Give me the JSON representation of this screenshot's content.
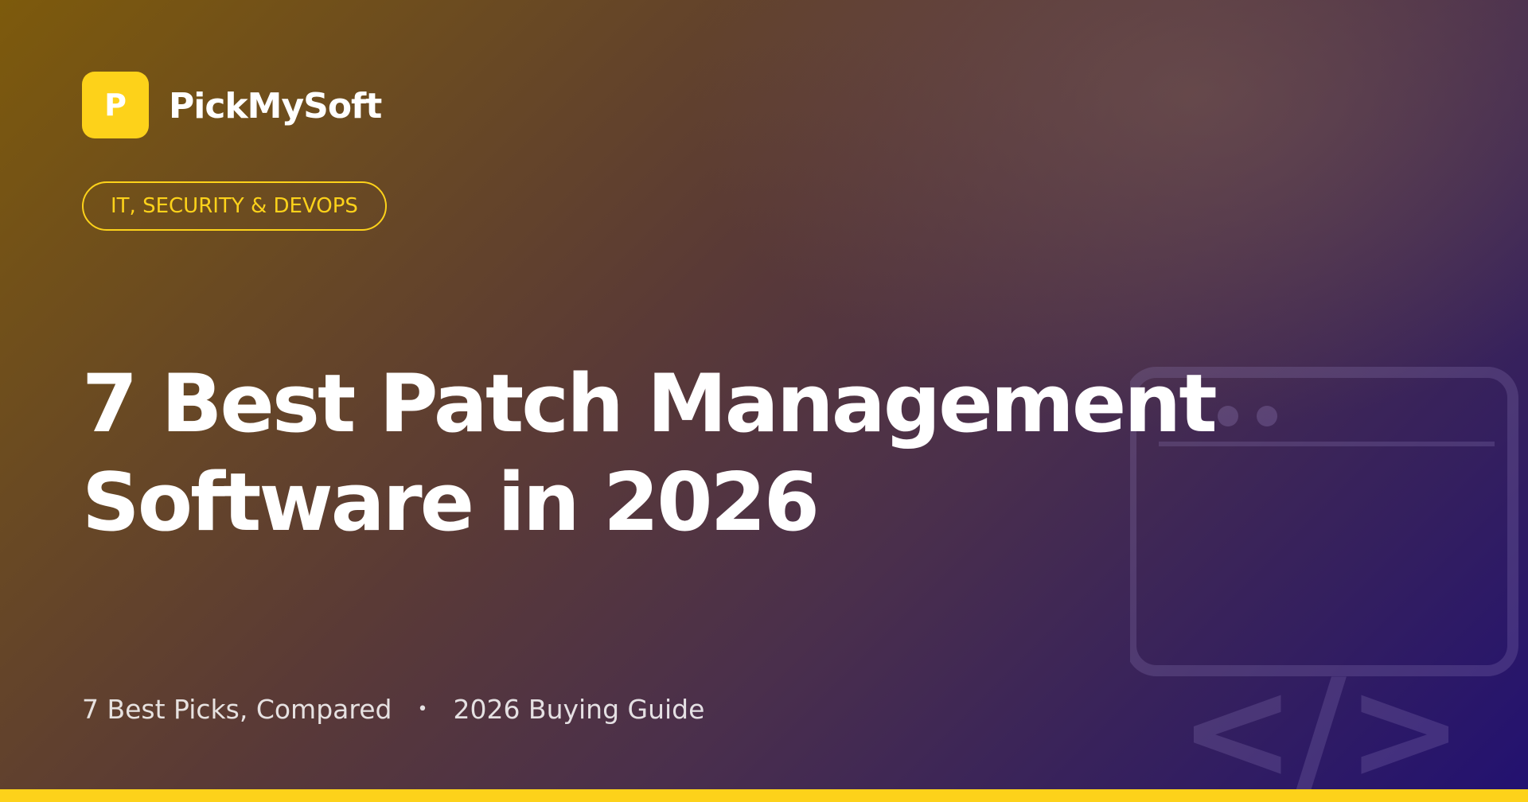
{
  "brand": {
    "logo_letter": "P",
    "name": "PickMySoft"
  },
  "category": {
    "label": "IT, SECURITY & DEVOPS"
  },
  "headline": {
    "line1": "7 Best Patch Management",
    "line2": "Software in 2026"
  },
  "meta": {
    "item1": "7 Best Picks, Compared",
    "separator": "•",
    "item2": "2026 Buying Guide"
  },
  "illustration": {
    "icon": "browser-window-code-icon",
    "code_glyph": "</>"
  },
  "colors": {
    "accent": "#fdd21a",
    "text": "#ffffff",
    "gradient_start": "#7d5a0c",
    "gradient_end": "#221171"
  }
}
